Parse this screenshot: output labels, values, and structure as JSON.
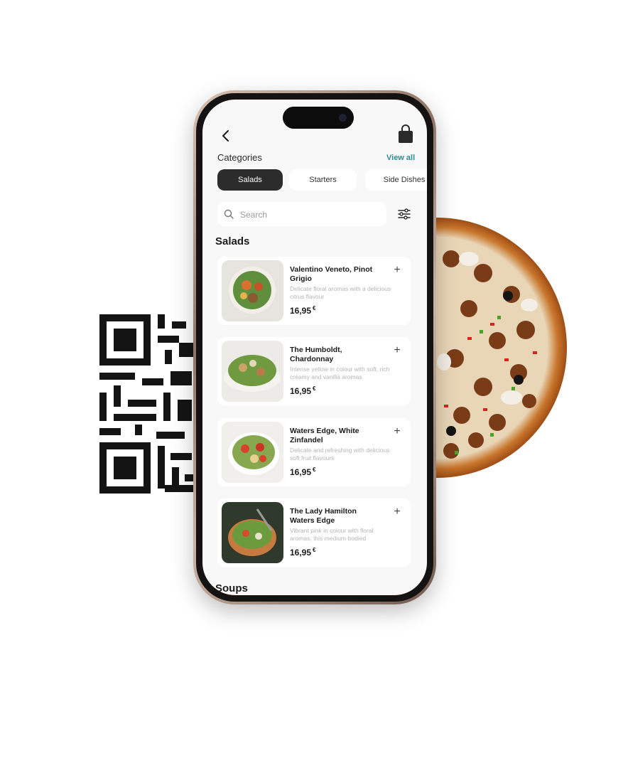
{
  "header": {
    "back_icon": "chevron-left-icon",
    "cart_icon": "shopping-bag-icon"
  },
  "categories": {
    "title": "Categories",
    "view_all": "View all",
    "chips": [
      {
        "label": "Salads",
        "active": true
      },
      {
        "label": "Starters",
        "active": false
      },
      {
        "label": "Side Dishes",
        "active": false
      }
    ]
  },
  "search": {
    "placeholder": "Search",
    "filter_icon": "sliders-icon"
  },
  "sections": {
    "salads": "Salads",
    "soups": "Soups"
  },
  "items": [
    {
      "name": "Valentino Veneto, Pinot Grigio",
      "description": "Delicate floral aromas with a delicious citrus flavour",
      "price": "16,95",
      "currency": "€",
      "add": "+"
    },
    {
      "name": "The Humboldt, Chardonnay",
      "description": "Intense yellow in colour with soft, rich creamy and vanilla aromas",
      "price": "16,95",
      "currency": "€",
      "add": "+"
    },
    {
      "name": "Waters Edge, White Zinfandel",
      "description": "Delicate and refreshing with delicious soft fruit flavours",
      "price": "16,95",
      "currency": "€",
      "add": "+"
    },
    {
      "name": "The Lady Hamilton Waters Edge",
      "description": "Vibrant pink in colour with floral aromas, this medium-bodied",
      "price": "16,95",
      "currency": "€",
      "add": "+"
    }
  ],
  "colors": {
    "accent": "#2d8f94",
    "chip_active": "#2c2c2c",
    "screen_bg": "#f9f8f9"
  }
}
